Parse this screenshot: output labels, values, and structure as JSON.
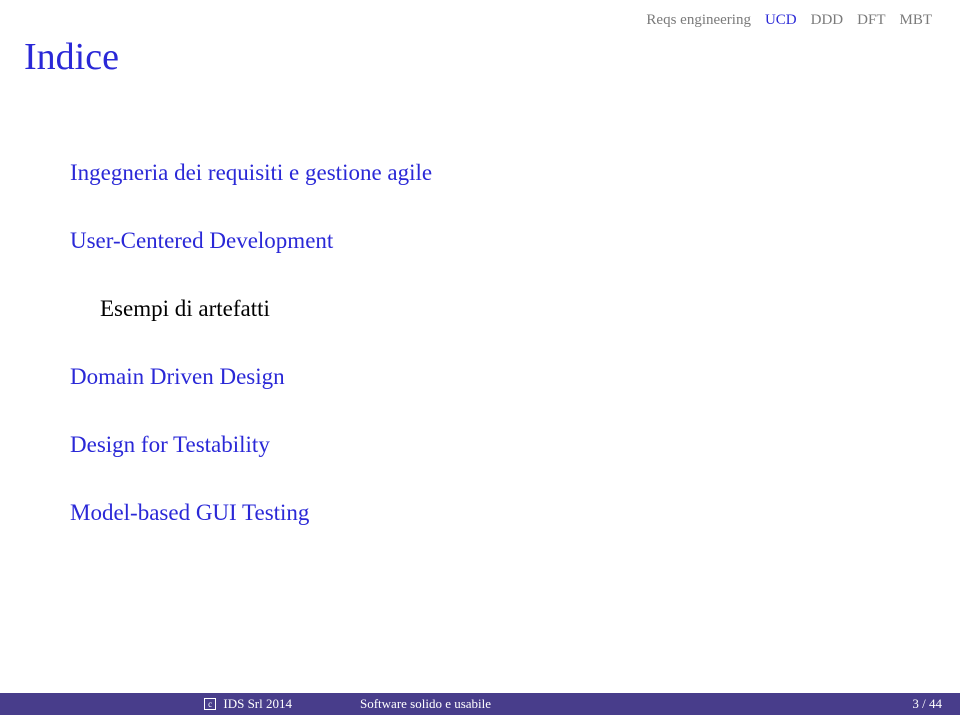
{
  "header": {
    "nav_items": [
      {
        "label": "Reqs engineering",
        "active": false
      },
      {
        "label": "UCD",
        "active": true
      },
      {
        "label": "DDD",
        "active": false
      },
      {
        "label": "DFT",
        "active": false
      },
      {
        "label": "MBT",
        "active": false
      }
    ]
  },
  "title": "Indice",
  "toc": {
    "item_1": "Ingegneria dei requisiti e gestione agile",
    "item_2": "User-Centered Development",
    "item_2_sub": "Esempi di artefatti",
    "item_3": "Domain Driven Design",
    "item_4": "Design for Testability",
    "item_5": "Model-based GUI Testing"
  },
  "footer": {
    "copyright": "c",
    "company": "IDS Srl 2014",
    "title": "Software solido e usabile",
    "page": "3 / 44"
  }
}
